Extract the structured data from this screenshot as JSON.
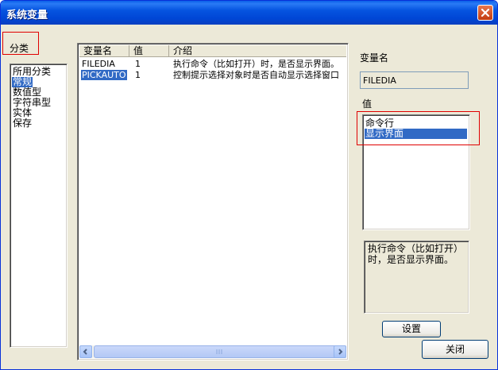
{
  "window": {
    "title": "系统变量"
  },
  "category": {
    "label": "分类",
    "items": [
      "所用分类",
      "常规",
      "数值型",
      "字符串型",
      "实体",
      "保存"
    ],
    "selected_index": 1
  },
  "table": {
    "columns": [
      "变量名",
      "值",
      "介绍"
    ],
    "rows": [
      {
        "name": "FILEDIA",
        "value": "1",
        "desc": "执行命令（比如打开）时，是否显示界面。"
      },
      {
        "name": "PICKAUTO",
        "value": "1",
        "desc": "控制提示选择对象时是否自动显示选择窗口"
      }
    ],
    "selected_name_row": 1
  },
  "right": {
    "varname_label": "变量名",
    "varname_value": "FILEDIA",
    "value_label": "值",
    "value_options": [
      "命令行",
      "显示界面"
    ],
    "value_selected_index": 1,
    "description": "执行命令（比如打开）时，是否显示界面。"
  },
  "buttons": {
    "settings": "设置",
    "close": "关闭"
  },
  "colors": {
    "selection": "#316AC5",
    "highlight_box": "#E00000",
    "title_bar": "#0054E3"
  }
}
